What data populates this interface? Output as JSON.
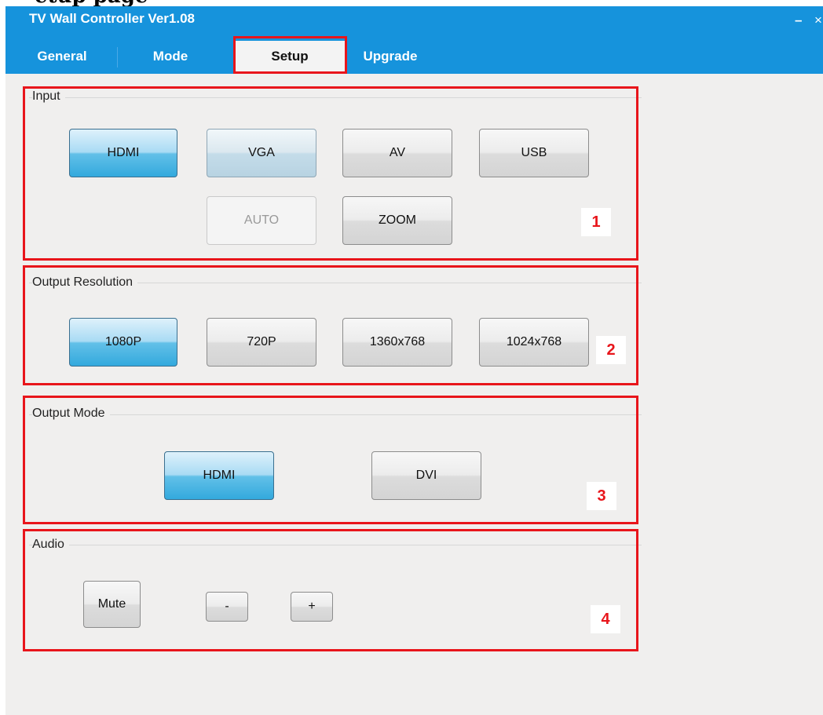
{
  "partial_heading": "etup page",
  "window": {
    "title": "TV Wall Controller Ver1.08",
    "minimize_glyph": "–",
    "close_glyph": "×"
  },
  "tabs": [
    {
      "label": "General"
    },
    {
      "label": "Mode"
    },
    {
      "label": "Setup",
      "active": true
    },
    {
      "label": "Upgrade"
    }
  ],
  "sections": {
    "input": {
      "title": "Input",
      "buttons": [
        "HDMI",
        "VGA",
        "AV",
        "USB",
        "AUTO",
        "ZOOM"
      ],
      "selected": "HDMI",
      "disabled": [
        "AUTO"
      ],
      "marker": "1"
    },
    "output_resolution": {
      "title": "Output Resolution",
      "buttons": [
        "1080P",
        "720P",
        "1360x768",
        "1024x768"
      ],
      "selected": "1080P",
      "marker": "2"
    },
    "output_mode": {
      "title": "Output Mode",
      "buttons": [
        "HDMI",
        "DVI"
      ],
      "selected": "HDMI",
      "marker": "3"
    },
    "audio": {
      "title": "Audio",
      "buttons": [
        "Mute",
        "-",
        "+"
      ],
      "marker": "4"
    }
  },
  "colors": {
    "titlebar": "#1693dc",
    "highlight": "#e8151b",
    "selected_button": "#33a9dd"
  }
}
